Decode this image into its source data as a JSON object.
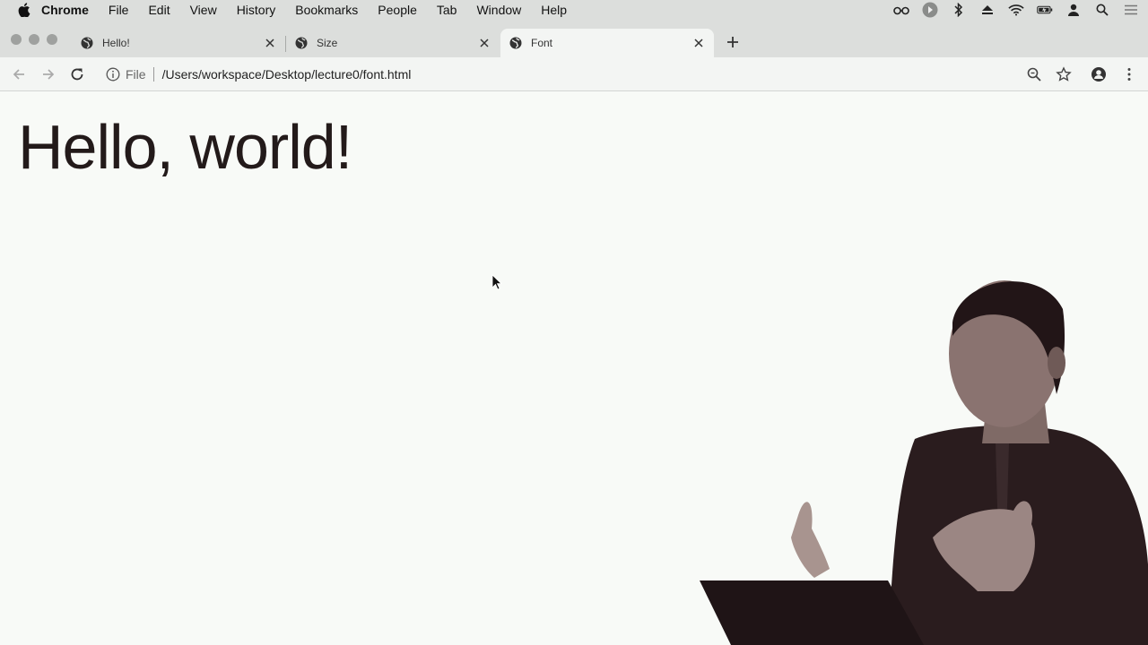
{
  "menubar": {
    "app": "Chrome",
    "items": [
      "File",
      "Edit",
      "View",
      "History",
      "Bookmarks",
      "People",
      "Tab",
      "Window",
      "Help"
    ]
  },
  "tabs": [
    {
      "title": "Hello!",
      "active": false
    },
    {
      "title": "Size",
      "active": false
    },
    {
      "title": "Font",
      "active": true
    }
  ],
  "omnibox": {
    "scheme_label": "File",
    "url": "/Users/workspace/Desktop/lecture0/font.html"
  },
  "page": {
    "heading": "Hello, world!"
  },
  "colors": {
    "chrome_frame": "#dcdedc",
    "toolbar": "#f3f5f3",
    "page_bg": "#f8faf7",
    "heading_text": "#231a1a"
  }
}
